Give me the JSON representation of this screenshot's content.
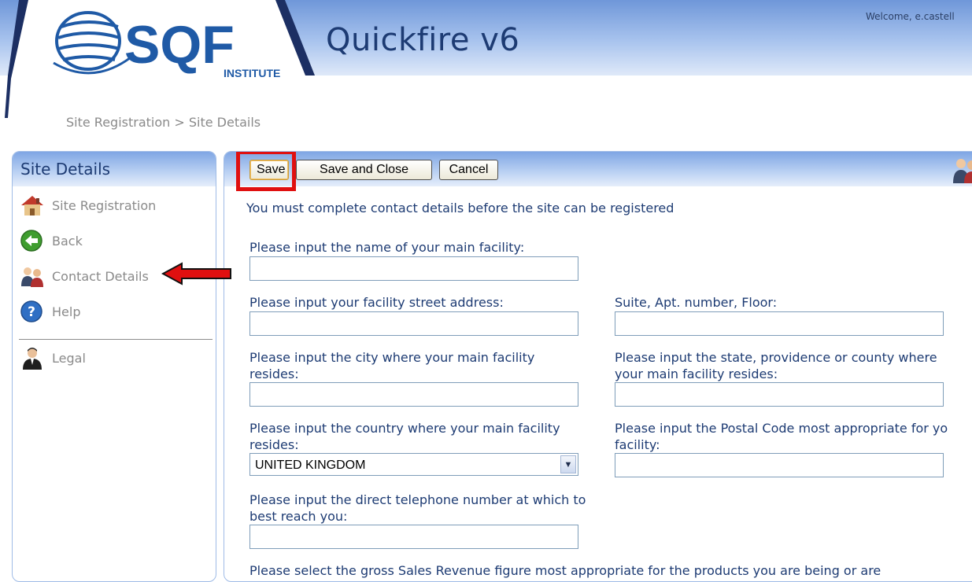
{
  "header": {
    "logo_text": "SQF",
    "logo_subtext": "INSTITUTE",
    "app_title": "Quickfire v6",
    "welcome": "Welcome, e.castell"
  },
  "breadcrumb": "Site Registration > Site Details",
  "sidebar": {
    "title": "Site Details",
    "items": [
      {
        "label": "Site Registration",
        "icon": "house-icon"
      },
      {
        "label": "Back",
        "icon": "back-arrow-icon"
      },
      {
        "label": "Contact Details",
        "icon": "contacts-people-icon"
      },
      {
        "label": "Help",
        "icon": "help-question-icon"
      },
      {
        "label": "Legal",
        "icon": "legal-person-icon"
      }
    ]
  },
  "toolbar": {
    "save_label": "Save",
    "save_close_label": "Save and Close",
    "cancel_label": "Cancel"
  },
  "form": {
    "notice": "You must complete contact details before the site can be registered",
    "facility_name_label": "Please input the name of your main facility:",
    "street_label": "Please input your facility street address:",
    "suite_label": "Suite, Apt. number, Floor:",
    "city_label_1": "Please input the city where your main facility",
    "city_label_2": "resides:",
    "state_label_1": "Please input the state, providence or county where",
    "state_label_2": "your main facility resides:",
    "country_label_1": "Please input the country where your main facility",
    "country_label_2": "resides:",
    "country_value": "UNITED KINGDOM",
    "postal_label_1": "Please input the Postal Code most appropriate for yo",
    "postal_label_2": "facility:",
    "phone_label_1": "Please input the direct telephone number at which to",
    "phone_label_2": "best reach you:",
    "revenue_label": "Please select the gross Sales Revenue figure most appropriate for the products you are being or are"
  },
  "colors": {
    "header_blue": "#6f97d9",
    "text_navy": "#1d3b73",
    "highlight_red": "#e01010"
  }
}
